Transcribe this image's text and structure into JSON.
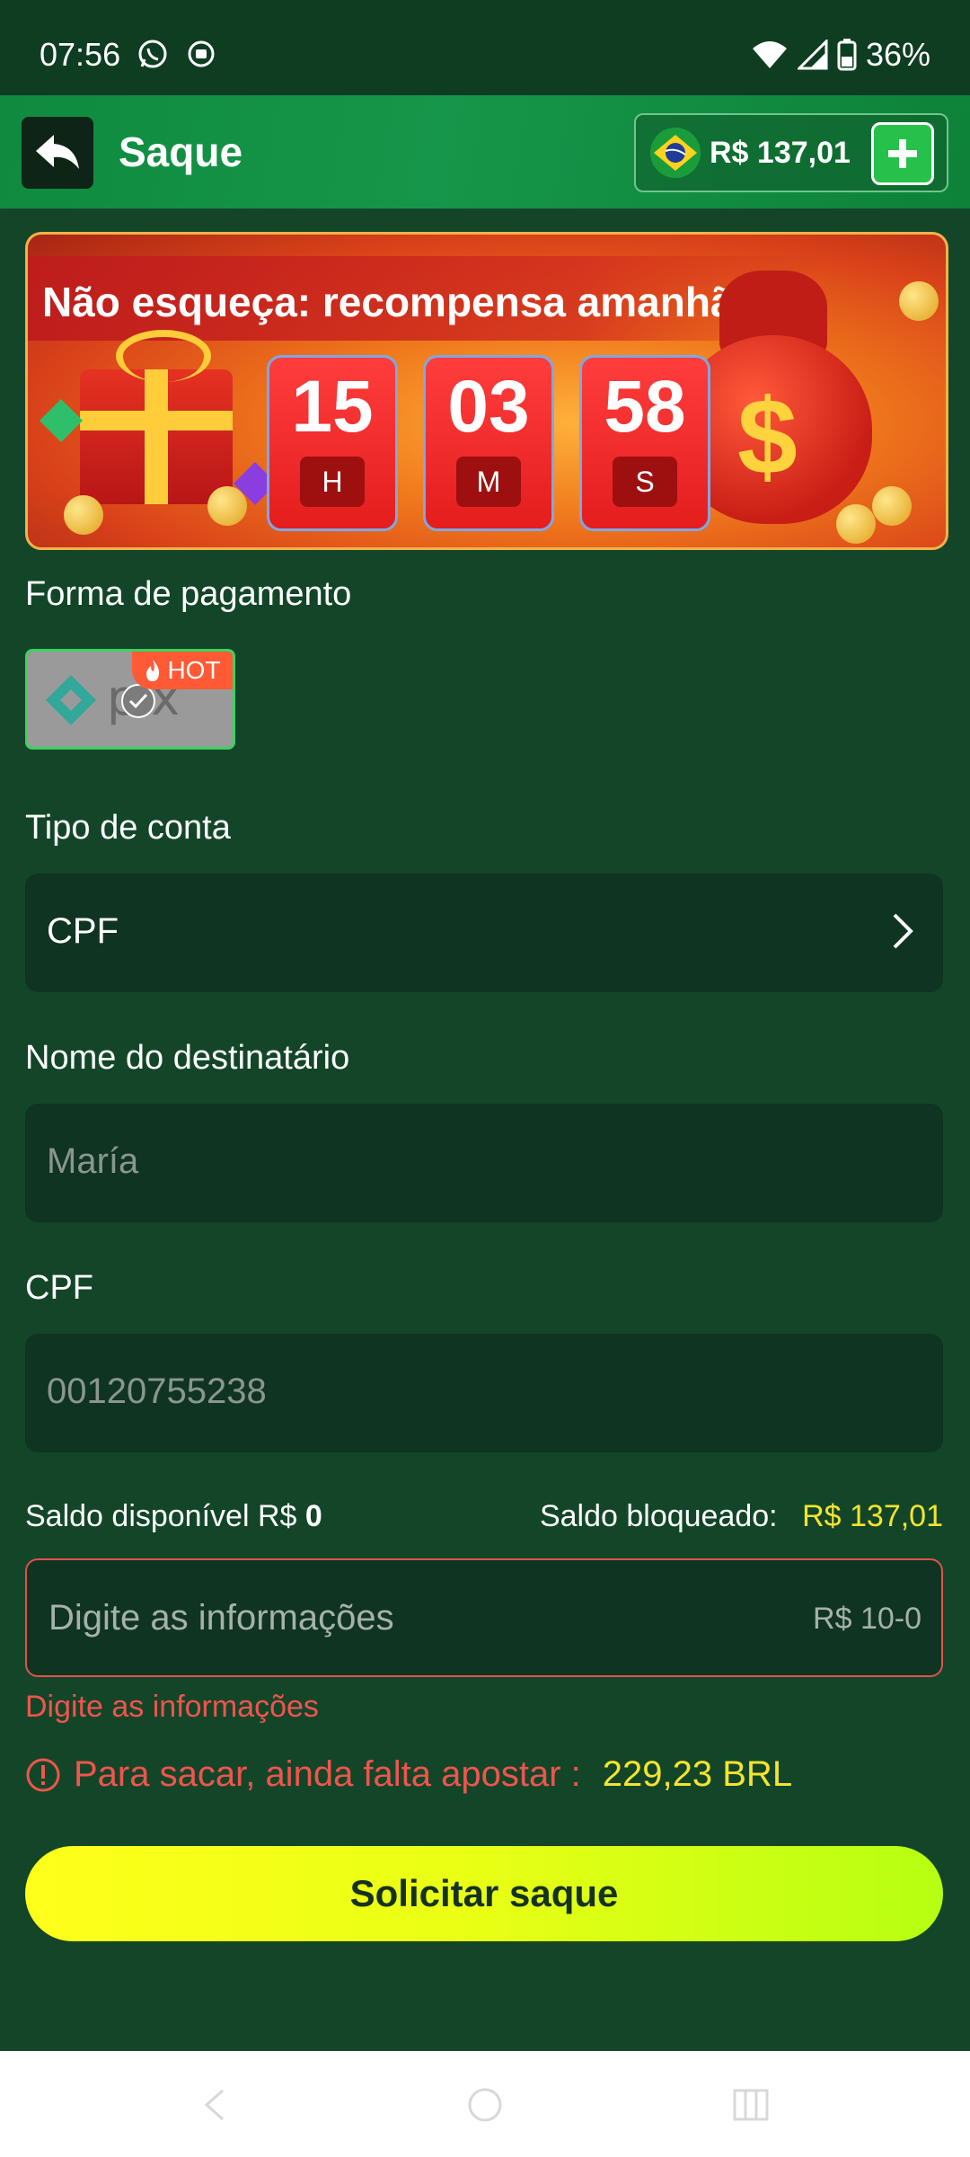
{
  "status_bar": {
    "time": "07:56",
    "battery": "36%"
  },
  "header": {
    "title": "Saque",
    "balance": "R$ 137,01"
  },
  "banner": {
    "title": "Não esqueça: recompensa amanhã",
    "countdown": [
      {
        "value": "15",
        "unit": "H"
      },
      {
        "value": "03",
        "unit": "M"
      },
      {
        "value": "58",
        "unit": "S"
      }
    ]
  },
  "payment": {
    "label": "Forma de pagamento",
    "method_word": "pix",
    "hot_badge": "HOT"
  },
  "account_type": {
    "label": "Tipo de conta",
    "value": "CPF"
  },
  "recipient": {
    "label": "Nome do destinatário",
    "value": "María"
  },
  "cpf": {
    "label": "CPF",
    "value": "00120755238"
  },
  "balances": {
    "available_label": "Saldo disponível R$",
    "available_value": "0",
    "blocked_label": "Saldo bloqueado:",
    "blocked_value": "R$ 137,01"
  },
  "amount": {
    "placeholder": "Digite as informações",
    "range": "R$ 10-0",
    "error": "Digite as informações"
  },
  "warning": {
    "text": "Para sacar, ainda falta apostar :",
    "value": "229,23 BRL"
  },
  "submit": {
    "label": "Solicitar saque"
  },
  "colors": {
    "background": "#134628",
    "header": "#16964a",
    "accent_yellow": "#f5e42e",
    "error_red": "#f0544e",
    "button_gradient_start": "#ffff1a",
    "button_gradient_end": "#b6ff12"
  }
}
